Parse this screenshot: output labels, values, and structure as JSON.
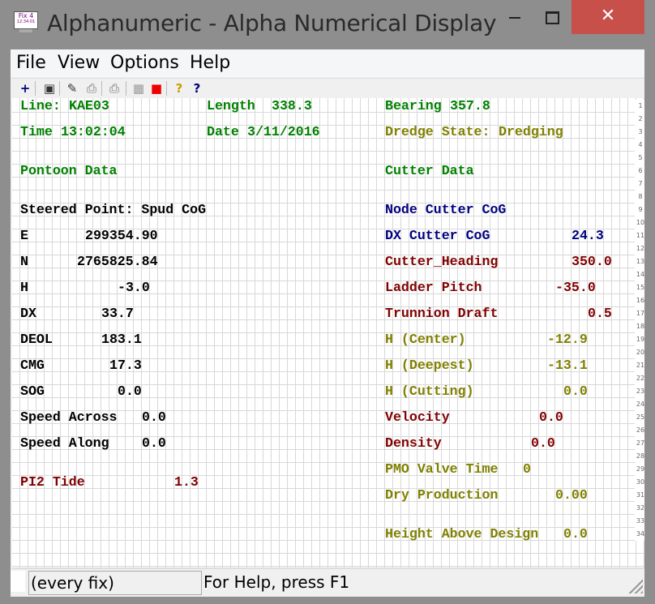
{
  "window": {
    "title": "Alphanumeric - Alpha Numerical Display",
    "icon_text": "Fix 4",
    "icon_subtext": "12:34:01",
    "minimize_icon": "minimize-icon",
    "maximize_icon": "maximize-icon",
    "close_label": "✕"
  },
  "menu": [
    "File",
    "View",
    "Options",
    "Help"
  ],
  "toolbar": [
    {
      "name": "new-icon",
      "glyph": "+",
      "color": "#000080"
    },
    {
      "name": "edit-window-icon",
      "glyph": "▣",
      "color": "#333"
    },
    {
      "name": "wizard-icon",
      "glyph": "✎",
      "color": "#333"
    },
    {
      "name": "print-icon",
      "glyph": "⎙",
      "color": "#aaa"
    },
    {
      "name": "print-preview-icon",
      "glyph": "⎙",
      "color": "#aaa"
    },
    {
      "name": "grid-icon",
      "glyph": "▦",
      "color": "#999"
    },
    {
      "name": "colors-icon",
      "glyph": "■",
      "color": "#e00"
    },
    {
      "name": "help-icon",
      "glyph": "?",
      "color": "#c8a000"
    },
    {
      "name": "context-help-icon",
      "glyph": "?",
      "color": "#000080"
    }
  ],
  "left": {
    "line": {
      "label": "Line:",
      "value": "KAE03"
    },
    "length": {
      "label": "Length",
      "value": "338.3"
    },
    "time": {
      "label": "Time",
      "value": "13:02:04"
    },
    "date": {
      "label": "Date",
      "value": "3/11/2016"
    },
    "section": "Pontoon Data",
    "steered": "Steered Point: Spud CoG",
    "rows": [
      {
        "label": "E",
        "value": "299354.90",
        "color": "black"
      },
      {
        "label": "N",
        "value": "2765825.84",
        "color": "black"
      },
      {
        "label": "H",
        "value": "-3.0",
        "color": "black"
      },
      {
        "label": "DX",
        "value": "33.7",
        "color": "black"
      },
      {
        "label": "DEOL",
        "value": "183.1",
        "color": "black"
      },
      {
        "label": "CMG",
        "value": "17.3",
        "color": "black"
      },
      {
        "label": "SOG",
        "value": "0.0",
        "color": "black"
      },
      {
        "label": "Speed Across",
        "value": "0.0",
        "color": "black"
      },
      {
        "label": "Speed Along",
        "value": "0.0",
        "color": "black"
      },
      {
        "label": "PI2 Tide",
        "value": "1.3",
        "color": "maroon"
      }
    ]
  },
  "right": {
    "bearing": {
      "label": "Bearing",
      "value": "357.8"
    },
    "dredge_state": {
      "label": "Dredge State:",
      "value": "Dredging"
    },
    "section": "Cutter Data",
    "node": "Node Cutter CoG",
    "rows": [
      {
        "label": "DX Cutter CoG",
        "value": "24.3",
        "color": "navy"
      },
      {
        "label": "Cutter_Heading",
        "value": "350.0",
        "color": "maroon"
      },
      {
        "label": "Ladder Pitch",
        "value": "-35.0",
        "color": "maroon"
      },
      {
        "label": "Trunnion Draft",
        "value": "0.5",
        "color": "maroon"
      },
      {
        "label": "H (Center)",
        "value": "-12.9",
        "color": "olive"
      },
      {
        "label": "H (Deepest)",
        "value": "-13.1",
        "color": "olive"
      },
      {
        "label": "H (Cutting)",
        "value": "0.0",
        "color": "olive"
      },
      {
        "label": "Velocity",
        "value": "0.0",
        "color": "maroon"
      },
      {
        "label": "Density",
        "value": "0.0",
        "color": "maroon"
      },
      {
        "label": "PMO Valve Time",
        "value": "0",
        "color": "olive"
      },
      {
        "label": "Dry Production",
        "value": "0.00",
        "color": "olive"
      },
      {
        "label": "Height Above Design",
        "value": "0.0",
        "color": "olive"
      }
    ]
  },
  "status": {
    "update_mode": "(every fix)",
    "help_text": "For Help, press F1"
  }
}
